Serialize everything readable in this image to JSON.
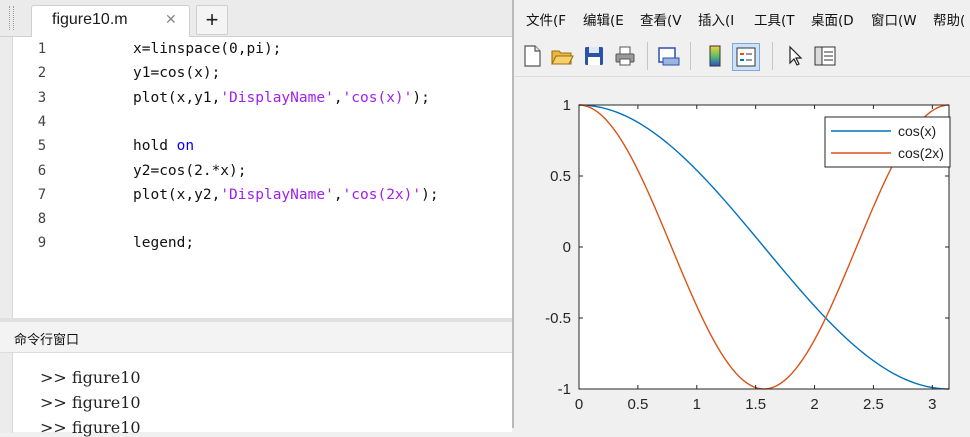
{
  "editor": {
    "tab_label": "figure10.m",
    "tab_close": "✕",
    "add_tab": "+",
    "lines": [
      {
        "num": "1",
        "parts": [
          {
            "t": "x=linspace(0,pi);",
            "c": ""
          }
        ]
      },
      {
        "num": "2",
        "parts": [
          {
            "t": "y1=cos(x);",
            "c": ""
          }
        ]
      },
      {
        "num": "3",
        "parts": [
          {
            "t": "plot(x,y1,",
            "c": ""
          },
          {
            "t": "'DisplayName'",
            "c": "str"
          },
          {
            "t": ",",
            "c": ""
          },
          {
            "t": "'cos(x)'",
            "c": "str"
          },
          {
            "t": ");",
            "c": ""
          }
        ]
      },
      {
        "num": "4",
        "parts": []
      },
      {
        "num": "5",
        "parts": [
          {
            "t": "hold ",
            "c": ""
          },
          {
            "t": "on",
            "c": "kw"
          }
        ]
      },
      {
        "num": "6",
        "parts": [
          {
            "t": "y2=cos(2.*x);",
            "c": ""
          }
        ]
      },
      {
        "num": "7",
        "parts": [
          {
            "t": "plot(x,y2,",
            "c": ""
          },
          {
            "t": "'DisplayName'",
            "c": "str"
          },
          {
            "t": ",",
            "c": ""
          },
          {
            "t": "'cos(2x)'",
            "c": "str"
          },
          {
            "t": ");",
            "c": ""
          }
        ]
      },
      {
        "num": "8",
        "parts": []
      },
      {
        "num": "9",
        "parts": [
          {
            "t": "legend;",
            "c": ""
          }
        ]
      }
    ]
  },
  "command_window": {
    "title": "命令行窗口",
    "lines": [
      ">> figure10",
      ">> figure10",
      ">> figure10"
    ]
  },
  "figure": {
    "menus": [
      "文件(F",
      "编辑(E",
      "查看(V",
      "插入(I",
      "工具(T",
      "桌面(D",
      "窗口(W",
      "帮助("
    ],
    "toolbar": [
      "new-figure-icon",
      "open-file-icon",
      "save-icon",
      "print-icon",
      "print-preview-icon",
      "colorbar-icon",
      "legend-icon",
      "pointer-icon",
      "plot-tools-icon"
    ]
  },
  "colors": {
    "series1": "#0072bd",
    "series2": "#d95319"
  },
  "chart_data": {
    "type": "line",
    "x_range": [
      0,
      3.14159
    ],
    "xlim": [
      0,
      3.14159
    ],
    "ylim": [
      -1,
      1
    ],
    "x_ticks": [
      0,
      0.5,
      1,
      1.5,
      2,
      2.5,
      3
    ],
    "x_tick_labels": [
      "0",
      "0.5",
      "1",
      "1.5",
      "2",
      "2.5",
      "3"
    ],
    "y_ticks": [
      -1,
      -0.5,
      0,
      0.5,
      1
    ],
    "y_tick_labels": [
      "-1",
      "-0.5",
      "0",
      "0.5",
      "1"
    ],
    "series": [
      {
        "name": "cos(x)",
        "formula": "cos(x)",
        "color": "#0072bd"
      },
      {
        "name": "cos(2x)",
        "formula": "cos(2x)",
        "color": "#d95319"
      }
    ],
    "legend": "top-right",
    "grid": false,
    "title": "",
    "xlabel": "",
    "ylabel": ""
  }
}
